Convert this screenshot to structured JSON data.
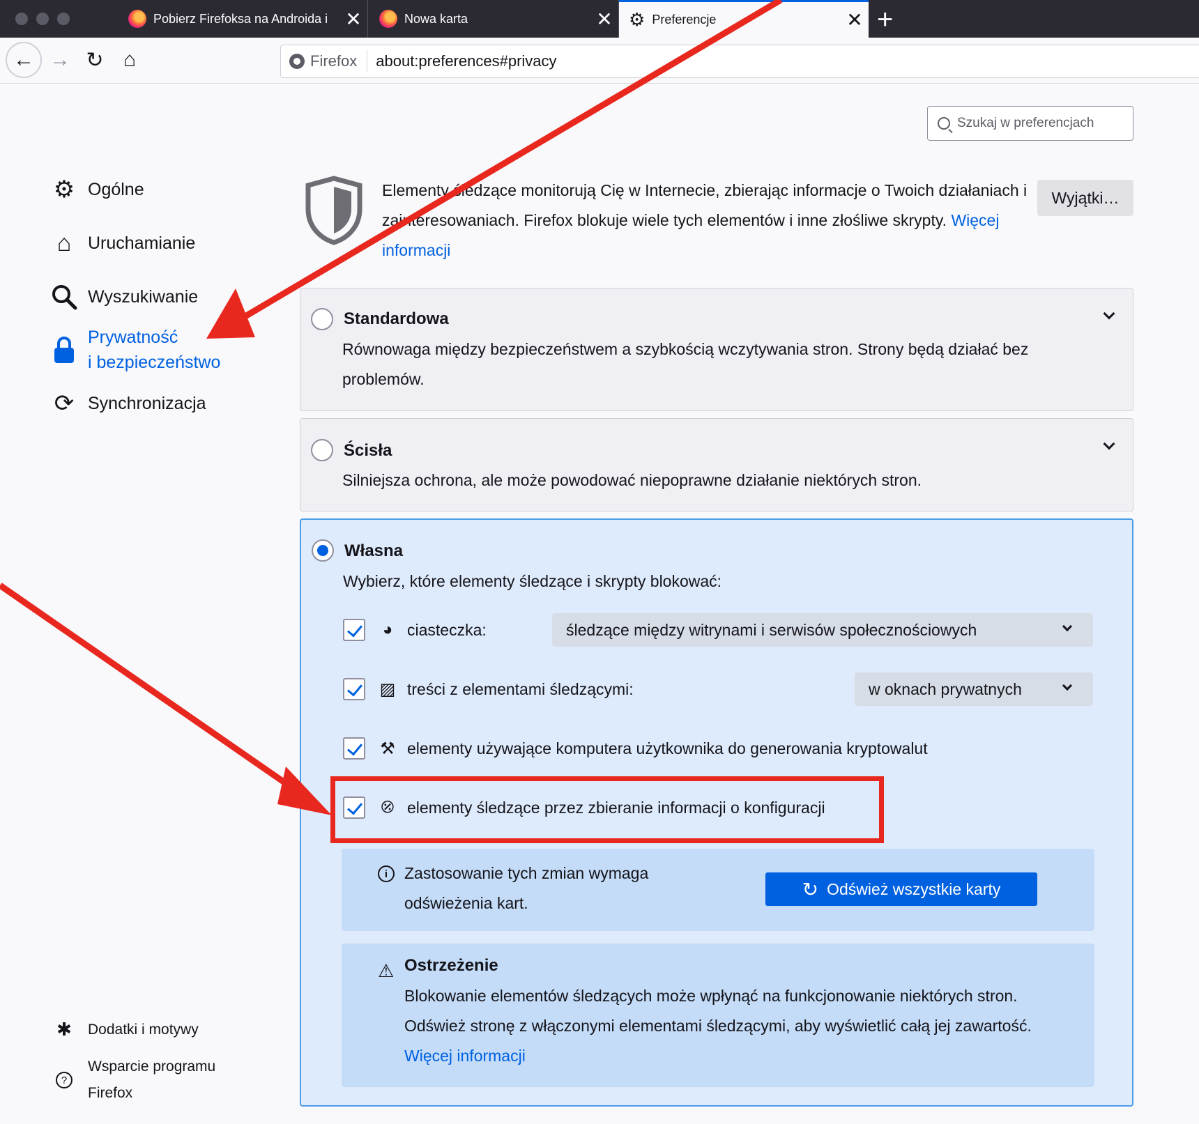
{
  "tabs": [
    {
      "title": "Pobierz Firefoksa na Androida i",
      "close": "✕"
    },
    {
      "title": "Nowa karta",
      "close": "✕"
    },
    {
      "title": "Preferencje",
      "close": "✕"
    }
  ],
  "new_tab": "+",
  "nav": {
    "back": "←",
    "forward": "→",
    "reload": "↻",
    "home": "⌂"
  },
  "urlbar": {
    "identity": "Firefox",
    "url": "about:preferences#privacy"
  },
  "search": {
    "placeholder": "Szukaj w preferencjach"
  },
  "sidebar": {
    "items": [
      {
        "label": "Ogólne",
        "icon": "gear-icon"
      },
      {
        "label": "Uruchamianie",
        "icon": "home-icon"
      },
      {
        "label": "Wyszukiwanie",
        "icon": "search-icon"
      },
      {
        "label_line1": "Prywatność",
        "label_line2": "i bezpieczeństwo",
        "icon": "lock-icon"
      },
      {
        "label": "Synchronizacja",
        "icon": "sync-icon"
      }
    ],
    "bottom": [
      {
        "label": "Dodatki i motywy",
        "icon": "puzzle-icon"
      },
      {
        "label_line1": "Wsparcie programu",
        "label_line2": "Firefox",
        "icon": "help-icon"
      }
    ]
  },
  "intro": {
    "text": "Elementy śledzące monitorują Cię w Internecie, zbierając informacje o Twoich działaniach i zainteresowaniach. Firefox blokuje wiele tych elementów i inne złośliwe skrypty.",
    "link": "Więcej informacji",
    "exceptions_button": "Wyjątki…"
  },
  "options": {
    "standard": {
      "title": "Standardowa",
      "desc": "Równowaga między bezpieczeństwem a szybkością wczytywania stron. Strony będą działać bez problemów."
    },
    "strict": {
      "title": "Ścisła",
      "desc": "Silniejsza ochrona, ale może powodować niepoprawne działanie niektórych stron."
    },
    "custom": {
      "title": "Własna",
      "prompt": "Wybierz, które elementy śledzące i skrypty blokować:",
      "rows": [
        {
          "label": "ciasteczka:",
          "checked": true,
          "select": "śledzące między witrynami i serwisów społecznościowych"
        },
        {
          "label": "treści z elementami śledzącymi:",
          "checked": true,
          "select": "w oknach prywatnych"
        },
        {
          "label": "elementy używające komputera użytkownika do generowania kryptowalut",
          "checked": true
        },
        {
          "label": "elementy śledzące przez zbieranie informacji o konfiguracji",
          "checked": true
        }
      ],
      "reload_notice": {
        "line1": "Zastosowanie tych zmian wymaga",
        "line2": "odświeżenia kart.",
        "button": "Odśwież wszystkie karty"
      },
      "warning": {
        "title": "Ostrzeżenie",
        "text": "Blokowanie elementów śledzących może wpłynąć na funkcjonowanie niektórych stron. Odśwież stronę z włączonymi elementami śledzącymi, aby wyświetlić całą jej zawartość.",
        "link": "Więcej informacji"
      }
    },
    "selected": "custom"
  },
  "annotation_color": "#e8281e"
}
